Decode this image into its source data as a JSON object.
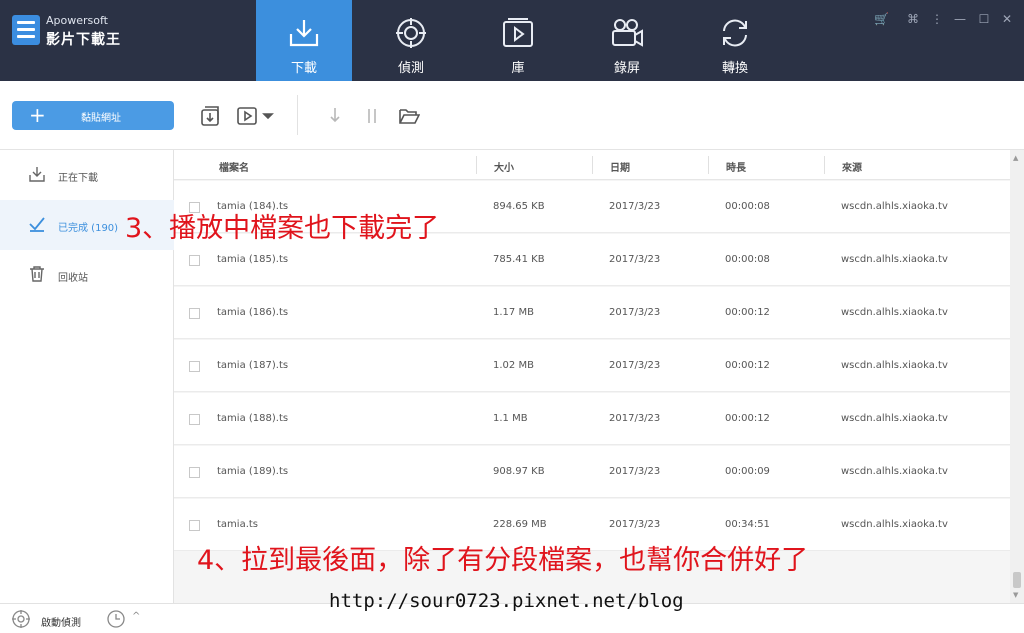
{
  "app": {
    "brand": "Apowersoft",
    "title": "影片下載王"
  },
  "nav": [
    {
      "label": "下載",
      "icon": "download-tray-icon",
      "active": true
    },
    {
      "label": "偵測",
      "icon": "crosshair-target-icon",
      "active": false
    },
    {
      "label": "庫",
      "icon": "media-library-icon",
      "active": false
    },
    {
      "label": "錄屏",
      "icon": "video-camera-icon",
      "active": false
    },
    {
      "label": "轉換",
      "icon": "convert-arrows-icon",
      "active": false
    }
  ],
  "toolbar": {
    "paste_label": "黏貼網址",
    "paste_icon": "plus-icon"
  },
  "sidebar": {
    "items": [
      {
        "label": "正在下載",
        "icon": "download-icon"
      },
      {
        "label": "已完成 (190)",
        "icon": "checkmark-icon"
      },
      {
        "label": "回收站",
        "icon": "trash-icon"
      }
    ]
  },
  "table": {
    "headers": [
      "檔案名",
      "大小",
      "日期",
      "時長",
      "來源"
    ],
    "rows": [
      {
        "name": "tamia (184).ts",
        "size": "894.65 KB",
        "date": "2017/3/23",
        "duration": "00:00:08",
        "source": "wscdn.alhls.xiaoka.tv"
      },
      {
        "name": "tamia (185).ts",
        "size": "785.41 KB",
        "date": "2017/3/23",
        "duration": "00:00:08",
        "source": "wscdn.alhls.xiaoka.tv"
      },
      {
        "name": "tamia (186).ts",
        "size": "1.17 MB",
        "date": "2017/3/23",
        "duration": "00:00:12",
        "source": "wscdn.alhls.xiaoka.tv"
      },
      {
        "name": "tamia (187).ts",
        "size": "1.02 MB",
        "date": "2017/3/23",
        "duration": "00:00:12",
        "source": "wscdn.alhls.xiaoka.tv"
      },
      {
        "name": "tamia (188).ts",
        "size": "1.1 MB",
        "date": "2017/3/23",
        "duration": "00:00:12",
        "source": "wscdn.alhls.xiaoka.tv"
      },
      {
        "name": "tamia (189).ts",
        "size": "908.97 KB",
        "date": "2017/3/23",
        "duration": "00:00:09",
        "source": "wscdn.alhls.xiaoka.tv"
      },
      {
        "name": "tamia.ts",
        "size": "228.69 MB",
        "date": "2017/3/23",
        "duration": "00:34:51",
        "source": "wscdn.alhls.xiaoka.tv"
      }
    ]
  },
  "bottombar": {
    "sniff_label": "啟動偵測"
  },
  "annotations": {
    "note3": "3、播放中檔案也下載完了",
    "note4": "4、拉到最後面，除了有分段檔案，也幫你合併好了",
    "watermark": "http://sour0723.pixnet.net/blog"
  },
  "colors": {
    "header_bg": "#2b3245",
    "accent": "#3c8fdd",
    "annotation": "#e0141c"
  }
}
